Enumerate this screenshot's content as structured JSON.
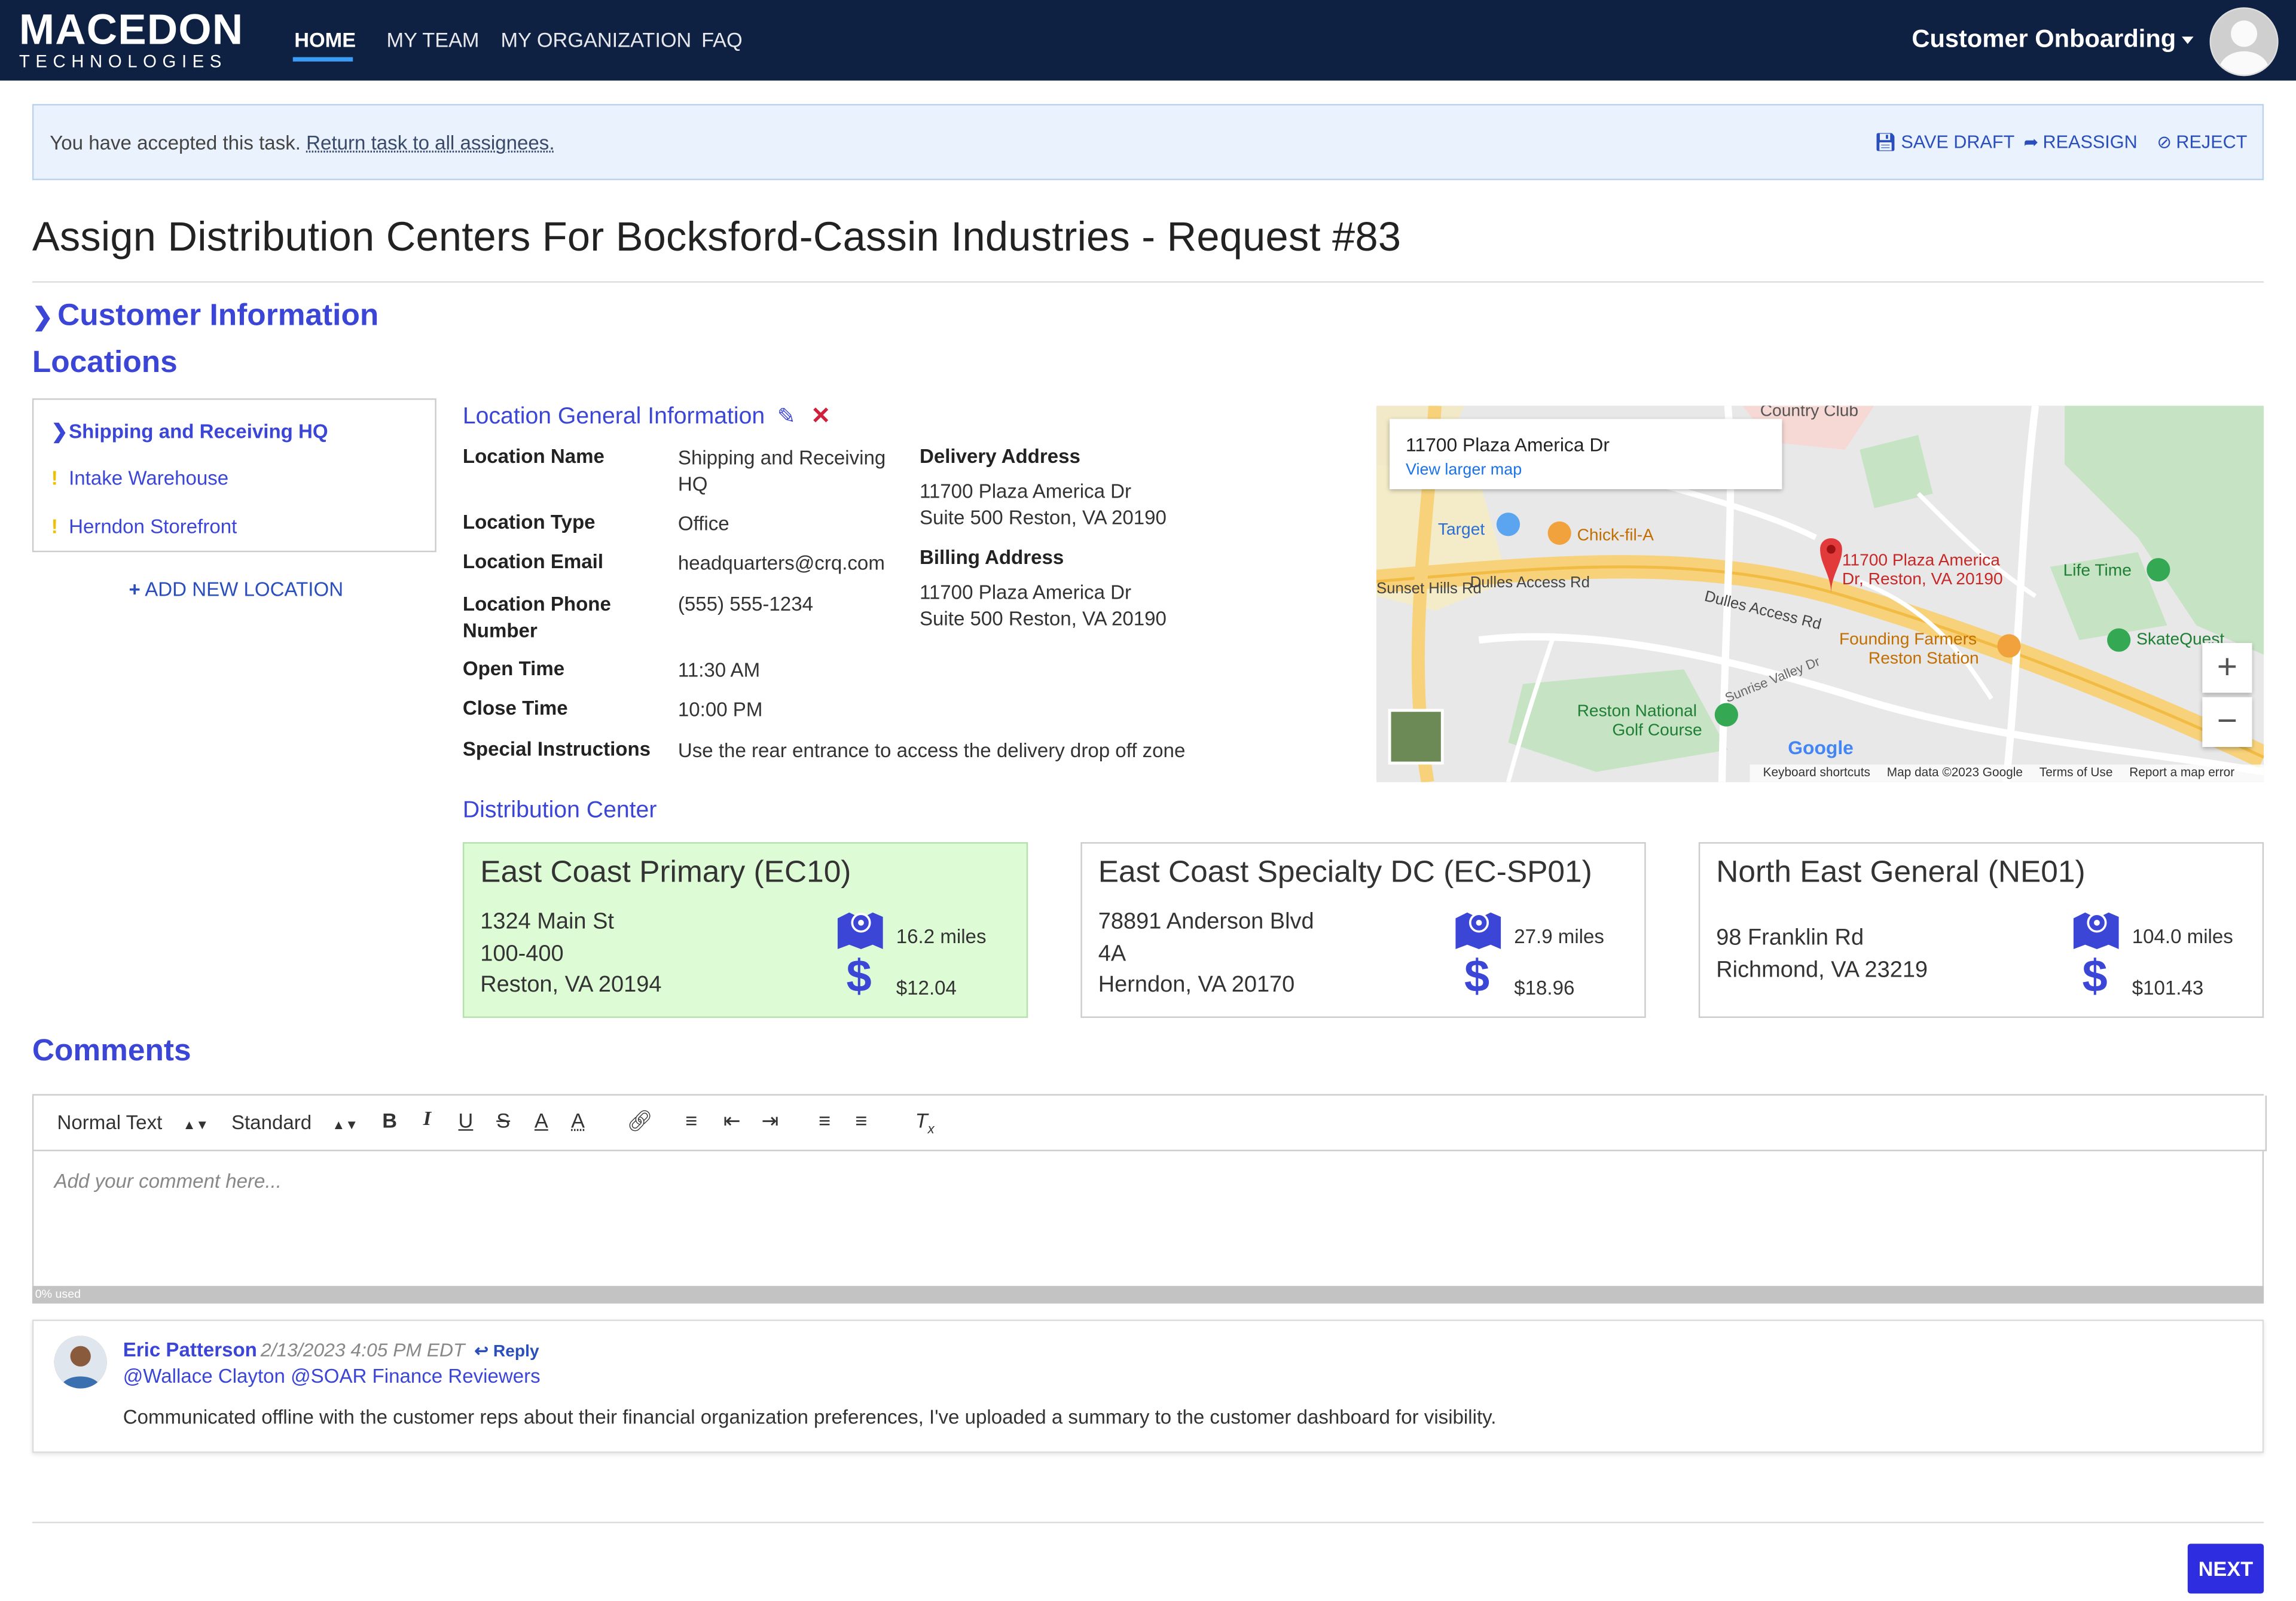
{
  "nav": {
    "logo_main": "MACEDON",
    "logo_sub": "TECHNOLOGIES",
    "items": [
      "HOME",
      "MY TEAM",
      "MY ORGANIZATION",
      "FAQ"
    ],
    "workflow": "Customer Onboarding"
  },
  "banner": {
    "text": "You have accepted this task.",
    "link": "Return task to all assignees.",
    "actions": [
      "SAVE DRAFT",
      "REASSIGN",
      "REJECT"
    ]
  },
  "page_title": "Assign Distribution Centers For Bocksford-Cassin Industries - Request #83",
  "sections": {
    "customer_info": "Customer Information",
    "locations": "Locations",
    "comments": "Comments"
  },
  "locations": {
    "items": [
      {
        "label": "Shipping and Receiving HQ",
        "marker": ">"
      },
      {
        "label": "Intake Warehouse",
        "marker": "!"
      },
      {
        "label": "Herndon Storefront",
        "marker": "!"
      }
    ],
    "add_label": "ADD NEW LOCATION"
  },
  "location_info": {
    "heading": "Location General Information",
    "name_label": "Location Name",
    "name_value_1": "Shipping and Receiving",
    "name_value_2": "HQ",
    "type_label": "Location Type",
    "type_value": "Office",
    "email_label": "Location Email",
    "email_value": "headquarters@crq.com",
    "phone_label_1": "Location Phone",
    "phone_label_2": "Number",
    "phone_value": "(555) 555-1234",
    "open_label": "Open Time",
    "open_value": "11:30 AM",
    "close_label": "Close Time",
    "close_value": "10:00 PM",
    "instructions_label": "Special Instructions",
    "instructions_value": "Use the rear entrance to access the delivery drop off zone",
    "delivery_label": "Delivery Address",
    "delivery_line1": "11700 Plaza America Dr",
    "delivery_line2": "Suite 500 Reston, VA 20190",
    "billing_label": "Billing Address",
    "billing_line1": "11700 Plaza America Dr",
    "billing_line2": "Suite 500 Reston, VA 20190"
  },
  "map": {
    "card_title": "11700 Plaza America Dr",
    "card_link": "View larger map",
    "pin_label_1": "11700 Plaza America",
    "pin_label_2": "Dr, Reston, VA 20190",
    "places": [
      "Target",
      "Chick-fil-A",
      "Life Time",
      "SkateQuest",
      "Founding Farmers",
      "Reston Station",
      "Reston National",
      "Golf Course",
      "Country Club",
      "Dulles Access Rd",
      "Dulles Access Rd",
      "Sunrise Valley Dr",
      "Sunset Hills Rd"
    ],
    "footer": [
      "Keyboard shortcuts",
      "Map data ©2023 Google",
      "Terms of Use",
      "Report a map error"
    ],
    "google": "Google"
  },
  "distribution": {
    "heading": "Distribution Center",
    "centers": [
      {
        "name": "East Coast Primary (EC10)",
        "addr": [
          "1324 Main St",
          "100-400",
          "Reston, VA 20194"
        ],
        "miles": "16.2 miles",
        "cost": "$12.04",
        "selected": true
      },
      {
        "name": "East Coast Specialty DC (EC-SP01)",
        "addr": [
          "78891 Anderson Blvd",
          "4A",
          "Herndon, VA 20170"
        ],
        "miles": "27.9 miles",
        "cost": "$18.96",
        "selected": false
      },
      {
        "name": "North East General (NE01)",
        "addr": [
          "98 Franklin Rd",
          "Richmond, VA 23219"
        ],
        "miles": "104.0 miles",
        "cost": "$101.43",
        "selected": false
      }
    ]
  },
  "editor": {
    "style_select": "Normal Text",
    "font_select": "Standard",
    "placeholder": "Add your comment here...",
    "usage": "0% used"
  },
  "comment": {
    "author": "Eric Patterson",
    "time": "2/13/2023 4:05 PM EDT",
    "reply": "Reply",
    "mentions": "@Wallace Clayton @SOAR Finance Reviewers",
    "text": "Communicated offline with the customer reps about their financial organization preferences, I've uploaded a summary to the customer dashboard for visibility."
  },
  "next_label": "NEXT",
  "colors": {
    "accent": "#3b46d6",
    "nav_bg": "#0f2143",
    "selected_card": "#ddfcd6",
    "next_button": "#2f2de0"
  }
}
